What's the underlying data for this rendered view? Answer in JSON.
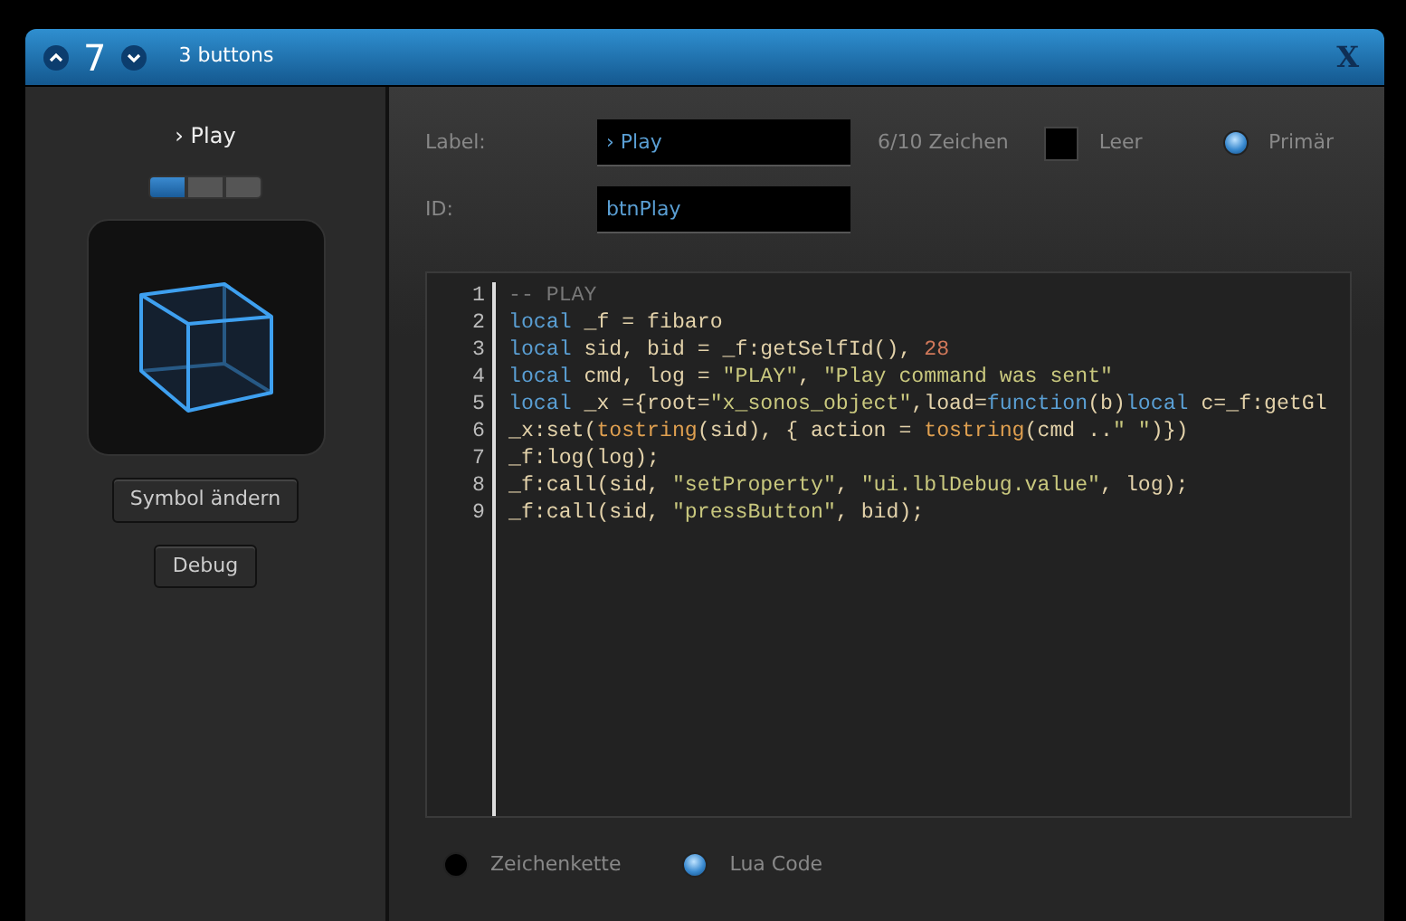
{
  "header": {
    "number": "7",
    "title": "3 buttons",
    "close": "X"
  },
  "preview": {
    "label": "› Play",
    "segments": [
      {
        "selected": true
      },
      {
        "selected": false
      },
      {
        "selected": false
      }
    ],
    "buttons": [
      "Symbol ändern",
      "Debug"
    ]
  },
  "form": {
    "label_caption": "Label:",
    "label_value": "› Play",
    "char_count": "6/10 Zeichen",
    "empty": {
      "label": "Leer",
      "checked": false
    },
    "primary": {
      "label": "Primär",
      "selected": true
    },
    "id_caption": "ID:",
    "id_value": "btnPlay"
  },
  "code_lines": [
    {
      "number": "1",
      "tokens": [
        {
          "kind": "comment",
          "text": "-- PLAY"
        }
      ]
    },
    {
      "number": "2",
      "tokens": [
        {
          "kind": "keyword",
          "text": "local"
        },
        {
          "kind": "plain",
          "text": " _f = fibaro"
        }
      ]
    },
    {
      "number": "3",
      "tokens": [
        {
          "kind": "keyword",
          "text": "local"
        },
        {
          "kind": "plain",
          "text": " sid, bid = _f:getSelfId(), "
        },
        {
          "kind": "number",
          "text": "28"
        }
      ]
    },
    {
      "number": "4",
      "tokens": [
        {
          "kind": "keyword",
          "text": "local"
        },
        {
          "kind": "plain",
          "text": " cmd, log = "
        },
        {
          "kind": "string",
          "text": "\"PLAY\""
        },
        {
          "kind": "plain",
          "text": ", "
        },
        {
          "kind": "string",
          "text": "\"Play command was sent\""
        }
      ]
    },
    {
      "number": "5",
      "tokens": [
        {
          "kind": "keyword",
          "text": "local"
        },
        {
          "kind": "plain",
          "text": " _x ={root="
        },
        {
          "kind": "string",
          "text": "\"x_sonos_object\""
        },
        {
          "kind": "plain",
          "text": ",load="
        },
        {
          "kind": "keyword",
          "text": "function"
        },
        {
          "kind": "plain",
          "text": "(b)"
        },
        {
          "kind": "keyword",
          "text": "local"
        },
        {
          "kind": "plain",
          "text": " c=_f:getGl"
        }
      ]
    },
    {
      "number": "6",
      "tokens": [
        {
          "kind": "plain",
          "text": "_x:set("
        },
        {
          "kind": "builtin",
          "text": "tostring"
        },
        {
          "kind": "plain",
          "text": "(sid), { action = "
        },
        {
          "kind": "builtin",
          "text": "tostring"
        },
        {
          "kind": "plain",
          "text": "(cmd .."
        },
        {
          "kind": "string",
          "text": "\" \""
        },
        {
          "kind": "plain",
          "text": ")})"
        }
      ]
    },
    {
      "number": "7",
      "tokens": [
        {
          "kind": "plain",
          "text": "_f:log(log);"
        }
      ]
    },
    {
      "number": "8",
      "tokens": [
        {
          "kind": "plain",
          "text": "_f:call(sid, "
        },
        {
          "kind": "string",
          "text": "\"setProperty\""
        },
        {
          "kind": "plain",
          "text": ", "
        },
        {
          "kind": "string",
          "text": "\"ui.lblDebug.value\""
        },
        {
          "kind": "plain",
          "text": ", log);"
        }
      ]
    },
    {
      "number": "9",
      "tokens": [
        {
          "kind": "plain",
          "text": "_f:call(sid, "
        },
        {
          "kind": "string",
          "text": "\"pressButton\""
        },
        {
          "kind": "plain",
          "text": ", bid);"
        }
      ]
    }
  ],
  "mode": [
    {
      "label": "Zeichenkette",
      "selected": false
    },
    {
      "label": "Lua Code",
      "selected": true
    }
  ]
}
